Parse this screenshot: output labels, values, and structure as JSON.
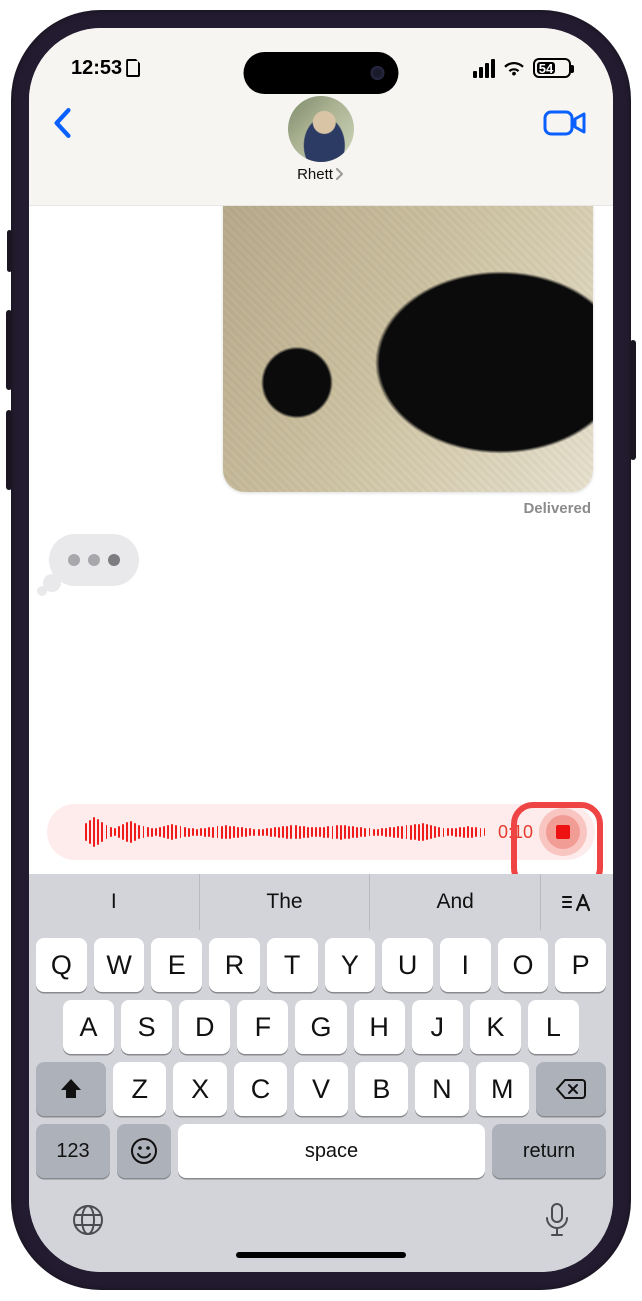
{
  "status": {
    "time": "12:53",
    "battery": "54"
  },
  "nav": {
    "contact_name": "Rhett"
  },
  "messages": {
    "delivered_label": "Delivered"
  },
  "audio": {
    "timer": "0:10"
  },
  "keyboard": {
    "suggestions": [
      "I",
      "The",
      "And"
    ],
    "row1": [
      "Q",
      "W",
      "E",
      "R",
      "T",
      "Y",
      "U",
      "I",
      "O",
      "P"
    ],
    "row2": [
      "A",
      "S",
      "D",
      "F",
      "G",
      "H",
      "J",
      "K",
      "L"
    ],
    "row3": [
      "Z",
      "X",
      "C",
      "V",
      "B",
      "N",
      "M"
    ],
    "numkey": "123",
    "space": "space",
    "return": "return"
  },
  "colors": {
    "accent": "#007aff",
    "record": "#e11"
  }
}
